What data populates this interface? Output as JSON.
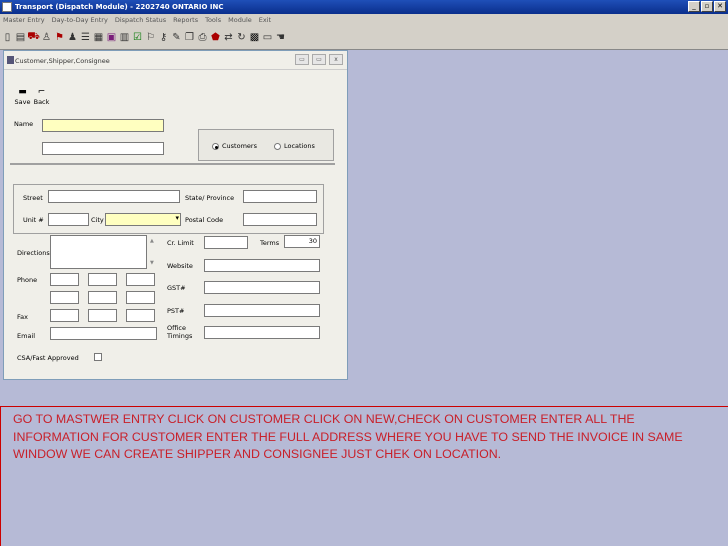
{
  "window": {
    "title": "Transport (Dispatch Module) - 2202740 ONTARIO INC"
  },
  "window_buttons": [
    "_",
    "▫",
    "✕"
  ],
  "menu": [
    "Master Entry",
    "Day-to-Day Entry",
    "Dispatch Status",
    "Reports",
    "Tools",
    "Module",
    "Exit"
  ],
  "child": {
    "title": "Customer,Shipper,Consignee",
    "btns": [
      "▭",
      "▭",
      "x"
    ]
  },
  "buttons": {
    "save": "Save",
    "back": "Back"
  },
  "labels": {
    "name": "Name",
    "street": "Street",
    "unit": "Unit #",
    "city": "City",
    "state": "State/ Province",
    "postal": "Postal Code",
    "directions": "Directions",
    "phone": "Phone",
    "fax": "Fax",
    "email": "Email",
    "csa": "CSA/Fast Approved",
    "cr_limit": "Cr. Limit",
    "terms": "Terms",
    "website": "Website",
    "gst": "GST#",
    "pst": "PST#",
    "office_timings": "Office\nTimings",
    "customers": "Customers",
    "locations": "Locations"
  },
  "values": {
    "terms": "30"
  },
  "caption": "GO TO MASTWER ENTRY CLICK ON CUSTOMER CLICK ON NEW,CHECK ON CUSTOMER ENTER ALL THE INFORMATION FOR CUSTOMER ENTER THE FULL ADDRESS WHERE YOU HAVE TO SEND THE INVOICE IN SAME WINDOW WE CAN CREATE SHIPPER AND CONSIGNEE JUST CHEK ON LOCATION."
}
